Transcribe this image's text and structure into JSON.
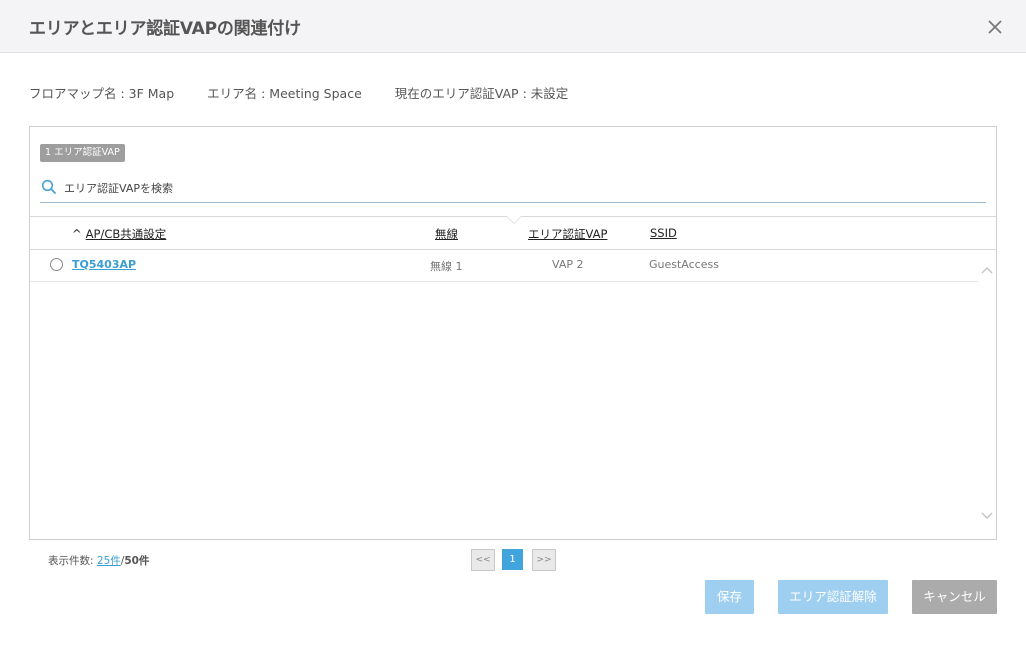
{
  "dialog": {
    "title": "エリアとエリア認証VAPの関連付け"
  },
  "info": {
    "floor_map": "フロアマップ名 : 3F Map",
    "area_name": "エリア名 : Meeting Space",
    "current_vap": "現在のエリア認証VAP : 未設定"
  },
  "panel": {
    "badge": "1 エリア認証VAP",
    "search_placeholder": "エリア認証VAPを検索"
  },
  "table": {
    "sort_caret": "^",
    "columns": [
      "AP/CB共通設定",
      "無線",
      "エリア認証VAP",
      "SSID"
    ],
    "rows": [
      {
        "name": "TQ5403AP",
        "radio": "無線 1",
        "vap": "VAP 2",
        "ssid": "GuestAccess"
      }
    ]
  },
  "footer": {
    "count_label": "表示件数:",
    "per_page": "25件",
    "separator": "/",
    "total": "50件",
    "pager_prev": "<<",
    "pager_current": "1",
    "pager_next": ">>"
  },
  "buttons": {
    "save": "保存",
    "release": "エリア認証解除",
    "cancel": "キャンセル"
  },
  "colors": {
    "accent": "#41a4dc",
    "link": "#3a9ed2",
    "disabled_primary": "#9fcff0",
    "cancel": "#ababab"
  }
}
